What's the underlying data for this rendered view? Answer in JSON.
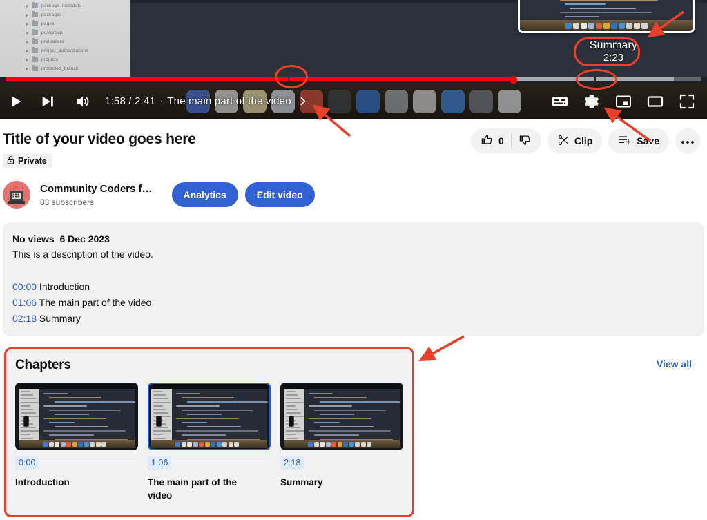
{
  "player": {
    "current_time": "1:58",
    "duration": "2:41",
    "time_display": "1:58 / 2:41",
    "current_chapter_label": "The main part of the video",
    "separator": "·",
    "progress_percent": 73,
    "buffered_percent": 96,
    "seek_tooltip": {
      "chapter_title": "Summary",
      "time": "2:23"
    },
    "controls": [
      {
        "name": "play-button",
        "icon": "play-icon",
        "label": "Play"
      },
      {
        "name": "next-button",
        "icon": "next-video-icon",
        "label": "Next"
      },
      {
        "name": "volume-button",
        "icon": "volume-icon",
        "label": "Volume"
      },
      {
        "name": "subtitles-button",
        "icon": "subtitles-icon",
        "label": "Subtitles"
      },
      {
        "name": "settings-button",
        "icon": "gear-icon",
        "label": "Settings"
      },
      {
        "name": "miniplayer-button",
        "icon": "miniplayer-icon",
        "label": "Miniplayer"
      },
      {
        "name": "theater-button",
        "icon": "theater-mode-icon",
        "label": "Theater mode"
      },
      {
        "name": "fullscreen-button",
        "icon": "fullscreen-icon",
        "label": "Full screen"
      }
    ],
    "video_file_tree": [
      "package_metadata",
      "packages",
      "pages",
      "postgroup",
      "preloaders",
      "project_authorizations",
      "projects",
      "protected_branch"
    ]
  },
  "video": {
    "title": "Title of your video goes here",
    "privacy_badge": "Private",
    "privacy_icon": "lock-icon"
  },
  "channel": {
    "name": "Community Coders f…",
    "subscribers": "83 subscribers",
    "avatar_icon": "retro-computer-avatar"
  },
  "owner_actions": [
    {
      "name": "analytics-button",
      "label": "Analytics"
    },
    {
      "name": "edit-video-button",
      "label": "Edit video"
    }
  ],
  "engagement": {
    "like_count": "0",
    "like_icon": "thumbs-up-icon",
    "dislike_icon": "thumbs-down-icon",
    "clip_label": "Clip",
    "clip_icon": "scissors-icon",
    "save_label": "Save",
    "save_icon": "add-to-playlist-icon",
    "more_icon": "more-horizontal-icon"
  },
  "description": {
    "views": "No views",
    "date": "6 Dec 2023",
    "text": "This is a description of the video.",
    "chapter_lines": [
      {
        "time": "00:00",
        "title": "Introduction"
      },
      {
        "time": "01:06",
        "title": "The main part of the video"
      },
      {
        "time": "02:18",
        "title": "Summary"
      }
    ]
  },
  "chapters_panel": {
    "heading": "Chapters",
    "view_all_label": "View all",
    "items": [
      {
        "time": "0:00",
        "title": "Introduction",
        "active": false
      },
      {
        "time": "1:06",
        "title": "The main part of the video",
        "active": true
      },
      {
        "time": "2:18",
        "title": "Summary",
        "active": false
      }
    ]
  },
  "colors": {
    "brand_red": "#ff0000",
    "annotation_red": "#e8402a",
    "accent_blue": "#3062d4",
    "link_blue": "#3060c0",
    "panel_gray": "#f2f2f2",
    "active_border_blue": "#1e5bd6"
  }
}
